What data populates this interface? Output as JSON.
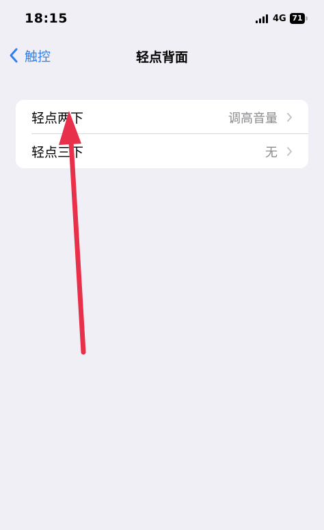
{
  "status_bar": {
    "time": "18:15",
    "network": "4G",
    "battery": "71"
  },
  "nav": {
    "back_label": "触控",
    "title": "轻点背面"
  },
  "settings": [
    {
      "label": "轻点两下",
      "value": "调高音量"
    },
    {
      "label": "轻点三下",
      "value": "无"
    }
  ],
  "colors": {
    "background": "#f0eff5",
    "accent": "#2f7ff0",
    "annotation_arrow": "#e8304a"
  },
  "icons": {
    "back": "chevron-left-icon",
    "row": "chevron-right-icon",
    "annotation": "red-arrow-annotation"
  }
}
